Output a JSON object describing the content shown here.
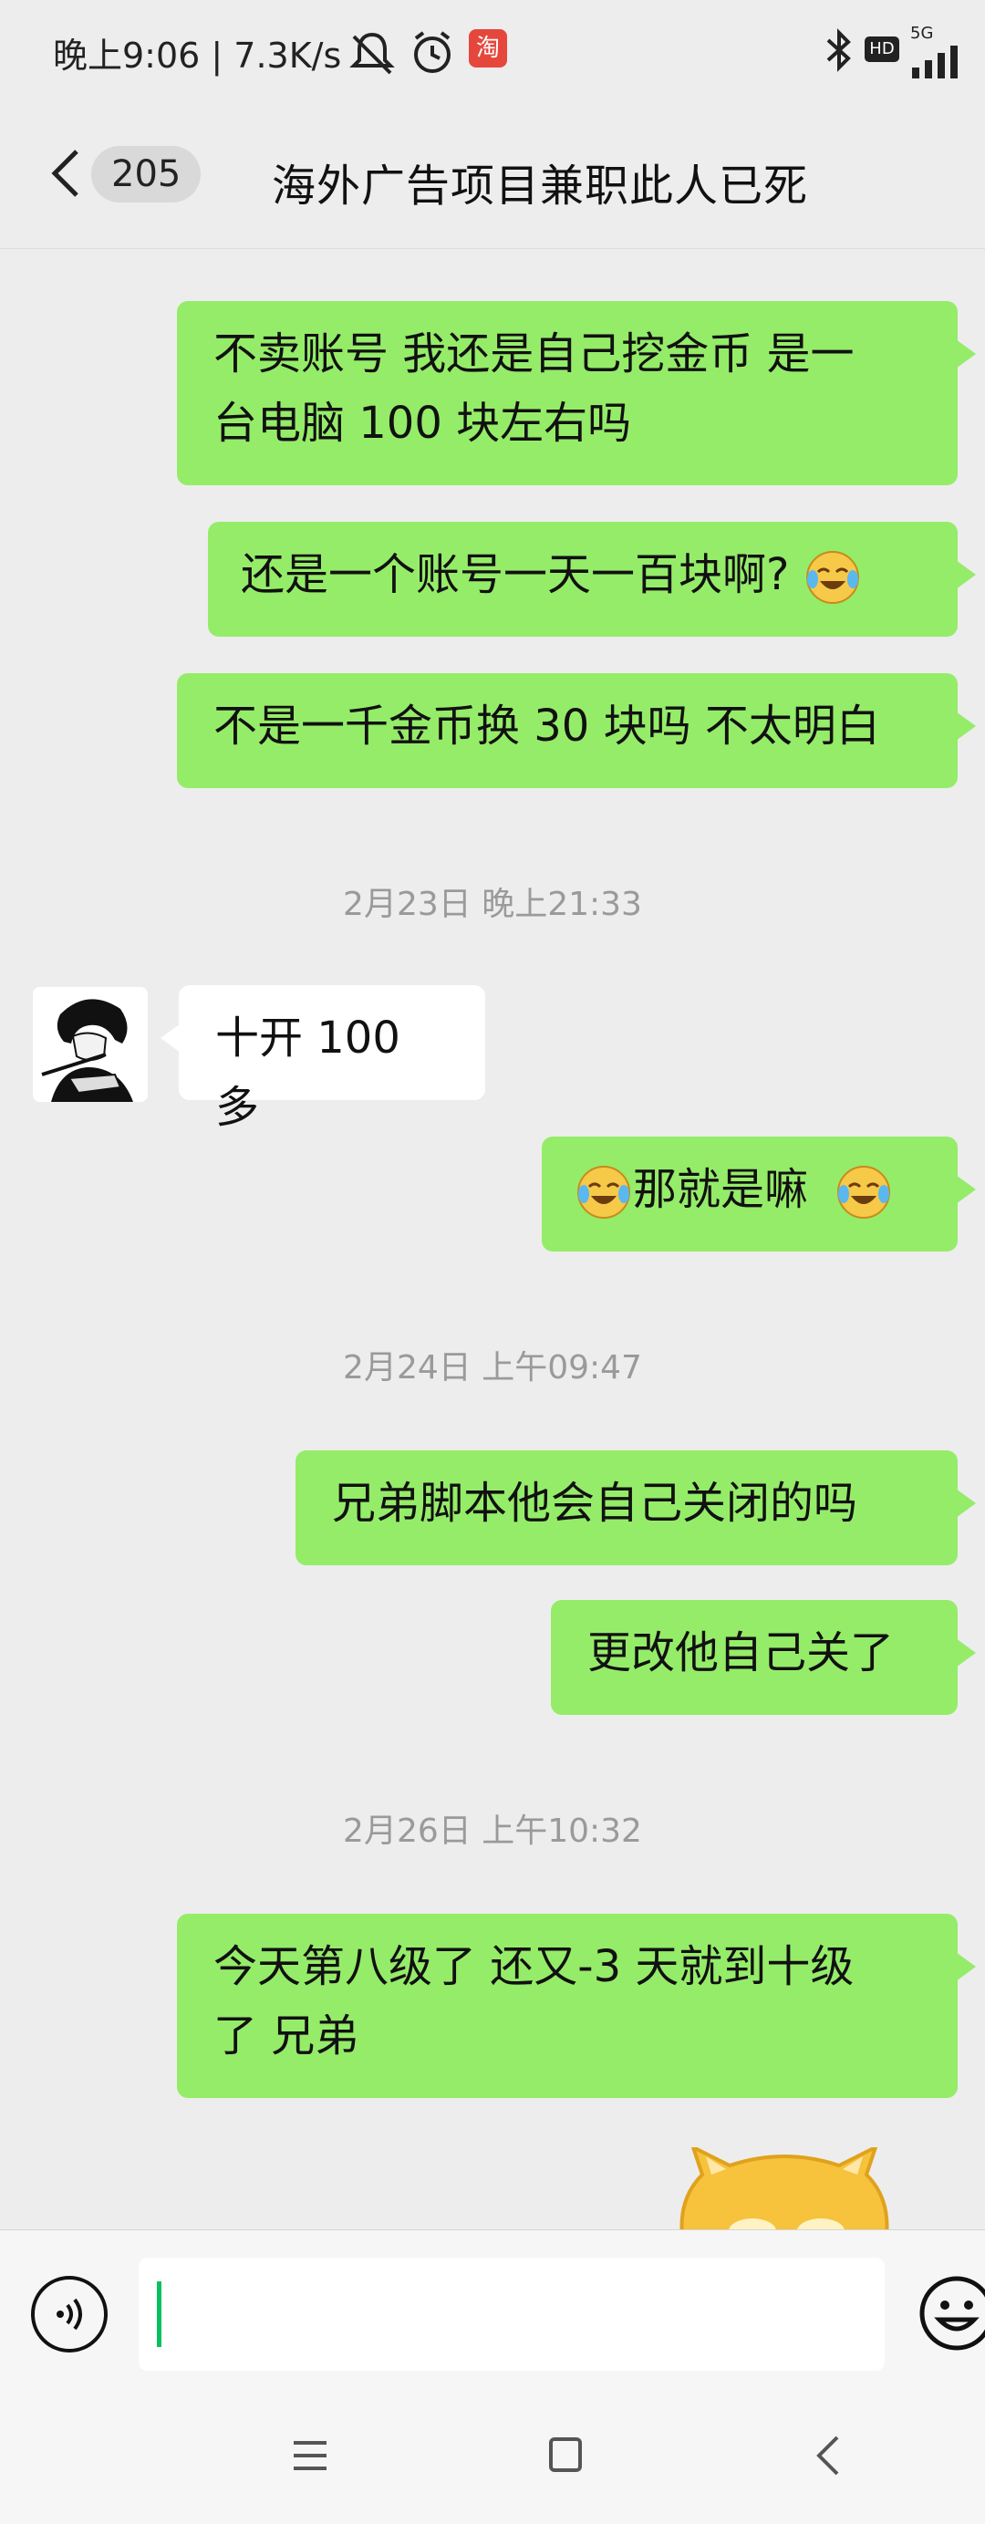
{
  "status_bar": {
    "time_speed": "晚上9:06 | 7.3K/s",
    "taobao_badge": "淘",
    "hd_label": "HD",
    "network_label": "5G"
  },
  "nav": {
    "unread_count": "205",
    "title": "海外广告项目兼职此人已死"
  },
  "messages": [
    {
      "side": "right",
      "lines": [
        "不卖账号 我还是自己挖金币 是一",
        "台电脑 100 块左右吗"
      ]
    },
    {
      "side": "right",
      "text": "还是一个账号一天一百块啊?"
    },
    {
      "side": "right",
      "text": "不是一千金币换 30 块吗 不太明白"
    },
    {
      "side": "left",
      "text": "十开 100 多"
    },
    {
      "side": "right",
      "text": "那就是嘛"
    },
    {
      "side": "right",
      "text": "兄弟脚本他会自己关闭的吗"
    },
    {
      "side": "right",
      "text": "更改他自己关了"
    },
    {
      "side": "right",
      "lines": [
        "今天第八级了 还又-3 天就到十级",
        "了 兄弟"
      ]
    }
  ],
  "timestamps": [
    "2月23日 晚上21:33",
    "2月24日 上午09:47",
    "2月26日 上午10:32"
  ],
  "colors": {
    "sent_bubble": "#95ec69",
    "received_bubble": "#ffffff",
    "background": "#ededed",
    "cursor": "#07c160"
  },
  "icons": {
    "voice": "voice-icon",
    "emoji": "emoji-icon",
    "laugh": "laugh-cry-emoji"
  }
}
